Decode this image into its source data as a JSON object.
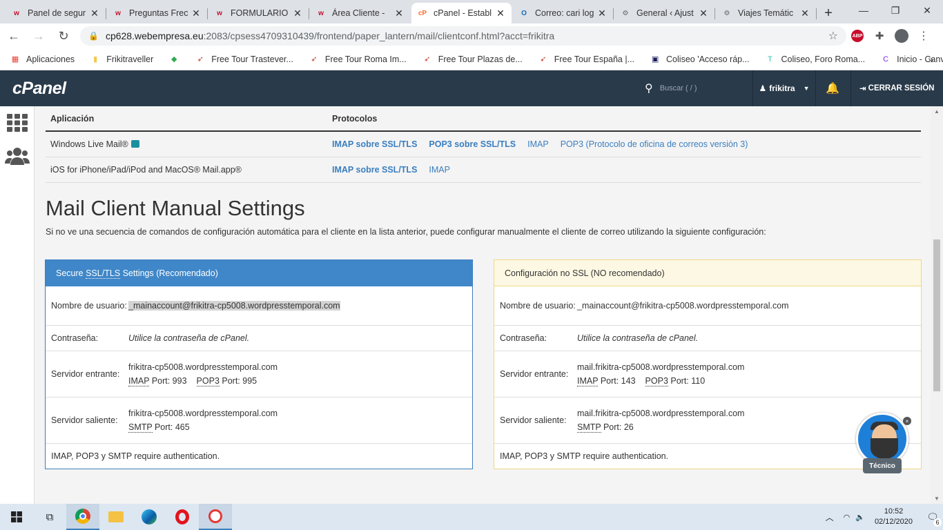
{
  "browser": {
    "tabs": [
      {
        "title": "Panel de segur",
        "favicon": "w",
        "color": "#c3102c"
      },
      {
        "title": "Preguntas Frec",
        "favicon": "w",
        "color": "#c3102c"
      },
      {
        "title": "FORMULARIO",
        "favicon": "w",
        "color": "#c3102c"
      },
      {
        "title": "Área Cliente - ",
        "favicon": "w",
        "color": "#c3102c"
      },
      {
        "title": "cPanel - Establ",
        "favicon": "cP",
        "color": "#ff6c2c"
      },
      {
        "title": "Correo: cari log",
        "favicon": "O",
        "color": "#0f6cbd"
      },
      {
        "title": "General ‹ Ajust",
        "favicon": "⚙",
        "color": "#666666"
      },
      {
        "title": "Viajes Temátic",
        "favicon": "⚙",
        "color": "#666666"
      }
    ],
    "url_host": "cp628.webempresa.eu",
    "url_path": ":2083/cpsess4709310439/frontend/paper_lantern/mail/clientconf.html?acct=frikitra",
    "bookmarks": [
      "Aplicaciones",
      "Frikitraveller",
      "",
      "Free Tour Trastever...",
      "Free Tour Roma Im...",
      "Free Tour Plazas de...",
      "Free Tour España |...",
      "Coliseo 'Acceso ráp...",
      "Coliseo, Foro Roma...",
      "Inicio - Canva"
    ]
  },
  "cpanel": {
    "logo": "cPanel",
    "search_placeholder": "Buscar ( / )",
    "user": "frikitra",
    "logout": "CERRAR SESIÓN"
  },
  "apps_table": {
    "headers": [
      "Aplicación",
      "Protocolos"
    ],
    "rows": [
      {
        "app": "Windows Live Mail®",
        "protocols": [
          "IMAP sobre SSL/TLS",
          "POP3 sobre SSL/TLS",
          "IMAP",
          "POP3 (Protocolo de oficina de correos versión 3)"
        ]
      },
      {
        "app": "iOS for iPhone/iPad/iPod and MacOS® Mail.app®",
        "protocols": [
          "IMAP sobre SSL/TLS",
          "IMAP"
        ]
      }
    ]
  },
  "manual": {
    "title": "Mail Client Manual Settings",
    "description": "Si no ve una secuencia de comandos de configuración automática para el cliente en la lista anterior, puede configurar manualmente el cliente de correo utilizando la siguiente configuración:"
  },
  "ssl_panel": {
    "title_pre": "Secure ",
    "title_abbr": "SSL/TLS",
    "title_post": " Settings (Recomendado)",
    "username_label": "Nombre de usuario:",
    "username": "_mainaccount@frikitra-cp5008.wordpresstemporal.com",
    "password_label": "Contraseña:",
    "password": "Utilice la contraseña de cPanel.",
    "incoming_label": "Servidor entrante:",
    "incoming_host": "frikitra-cp5008.wordpresstemporal.com",
    "incoming_imap": "IMAP",
    "incoming_imap_port": " Port: 993",
    "incoming_pop": "POP3",
    "incoming_pop_port": " Port: 995",
    "outgoing_label": "Servidor saliente:",
    "outgoing_host": "frikitra-cp5008.wordpresstemporal.com",
    "outgoing_smtp": "SMTP",
    "outgoing_smtp_port": " Port: 465",
    "footer": "IMAP, POP3 y SMTP require authentication."
  },
  "nossl_panel": {
    "title": "Configuración no SSL (NO recomendado)",
    "username_label": "Nombre de usuario:",
    "username": "_mainaccount@frikitra-cp5008.wordpresstemporal.com",
    "password_label": "Contraseña:",
    "password": "Utilice la contraseña de cPanel.",
    "incoming_label": "Servidor entrante:",
    "incoming_host": "mail.frikitra-cp5008.wordpresstemporal.com",
    "incoming_imap": "IMAP",
    "incoming_imap_port": " Port: 143",
    "incoming_pop": "POP3",
    "incoming_pop_port": " Port: 110",
    "outgoing_label": "Servidor saliente:",
    "outgoing_host": "mail.frikitra-cp5008.wordpresstemporal.com",
    "outgoing_smtp": "SMTP",
    "outgoing_smtp_port": " Port: 26",
    "footer": "IMAP, POP3 y SMTP require authentication."
  },
  "chat": {
    "label": "Técnico"
  },
  "taskbar": {
    "time": "10:52",
    "date": "02/12/2020",
    "notifications": "6"
  }
}
